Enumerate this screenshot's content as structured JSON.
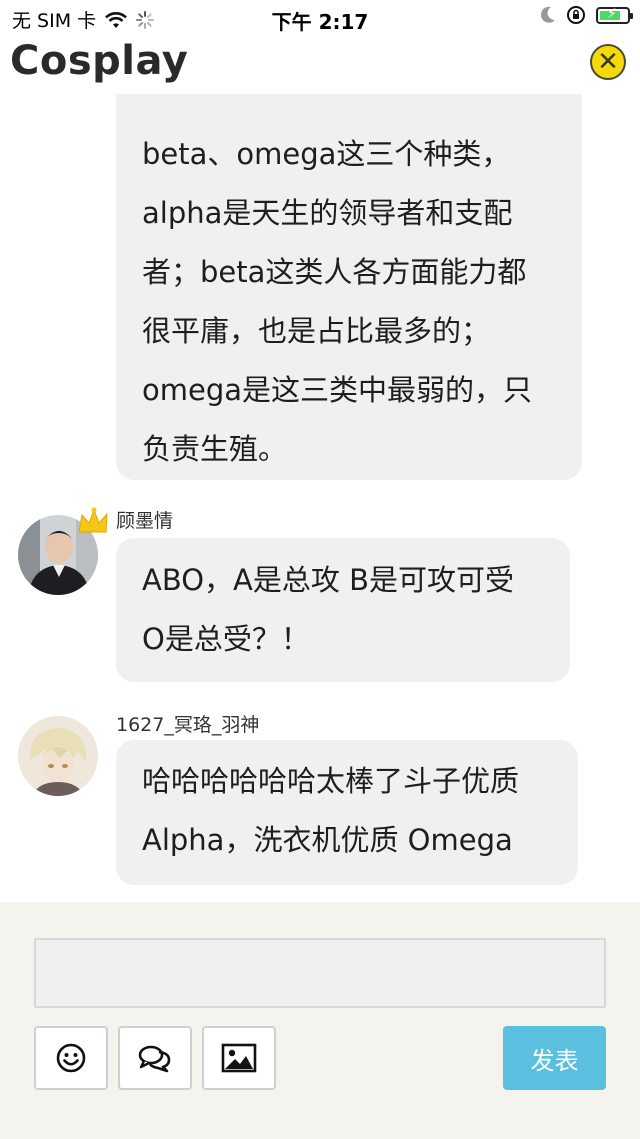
{
  "status_bar": {
    "carrier": "无 SIM 卡",
    "time": "下午 2:17",
    "battery_level": 0.75
  },
  "header": {
    "title": "Cosplay"
  },
  "messages": [
    {
      "lines": [
        "beta、omega这三个种类，",
        "alpha是天生的领导者和支配",
        "者；beta这类人各方面能力都",
        "很平庸，也是占比最多的；",
        "omega是这三类中最弱的，只",
        "负责生殖。"
      ]
    },
    {
      "username": "顾墨情",
      "avatar": "avatar-boy-in-suit",
      "badge": "crown-icon",
      "lines": [
        "ABO，A是总攻 B是可攻可受",
        "O是总受？！"
      ]
    },
    {
      "username": "1627_冥珞_羽神",
      "avatar": "avatar-anime-character",
      "lines": [
        "哈哈哈哈哈哈太棒了斗子优质",
        "Alpha，洗衣机优质 Omega"
      ]
    }
  ],
  "composer": {
    "input_value": "",
    "send_label": "发表",
    "tools": [
      "emoji-icon",
      "chat-bubbles-icon",
      "image-icon"
    ]
  },
  "colors": {
    "accent": "#5bbfe0",
    "close": "#f5d90a",
    "bubble": "#f0f0f0",
    "composer_bg": "#f5f3ee"
  }
}
